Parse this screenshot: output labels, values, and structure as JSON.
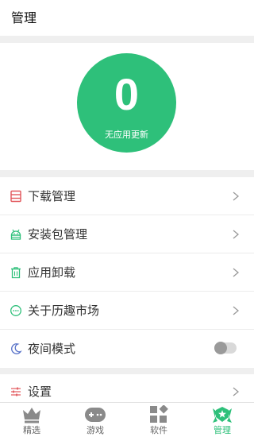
{
  "header": {
    "title": "管理"
  },
  "hero": {
    "count": "0",
    "subtitle": "无应用更新",
    "color": "#2ec07a"
  },
  "menu": {
    "items": [
      {
        "label": "下载管理",
        "icon": "list-icon",
        "icon_color": "#e2565b"
      },
      {
        "label": "安装包管理",
        "icon": "android-icon",
        "icon_color": "#2ec07a"
      },
      {
        "label": "应用卸载",
        "icon": "trash-icon",
        "icon_color": "#2ec07a"
      },
      {
        "label": "关于历趣市场",
        "icon": "chat-bubble-icon",
        "icon_color": "#2ec07a"
      },
      {
        "label": "夜间模式",
        "icon": "moon-icon",
        "icon_color": "#5a74c9",
        "toggle": "off"
      }
    ],
    "settings": {
      "label": "设置",
      "icon": "sliders-icon",
      "icon_color": "#e2565b"
    }
  },
  "tabbar": {
    "tabs": [
      {
        "label": "精选",
        "icon": "crown-icon"
      },
      {
        "label": "游戏",
        "icon": "gamepad-icon"
      },
      {
        "label": "软件",
        "icon": "apps-grid-icon"
      },
      {
        "label": "管理",
        "icon": "star-badge-icon",
        "active": true
      }
    ],
    "active_color": "#2ec07a",
    "inactive_color": "#8a8a8a"
  }
}
